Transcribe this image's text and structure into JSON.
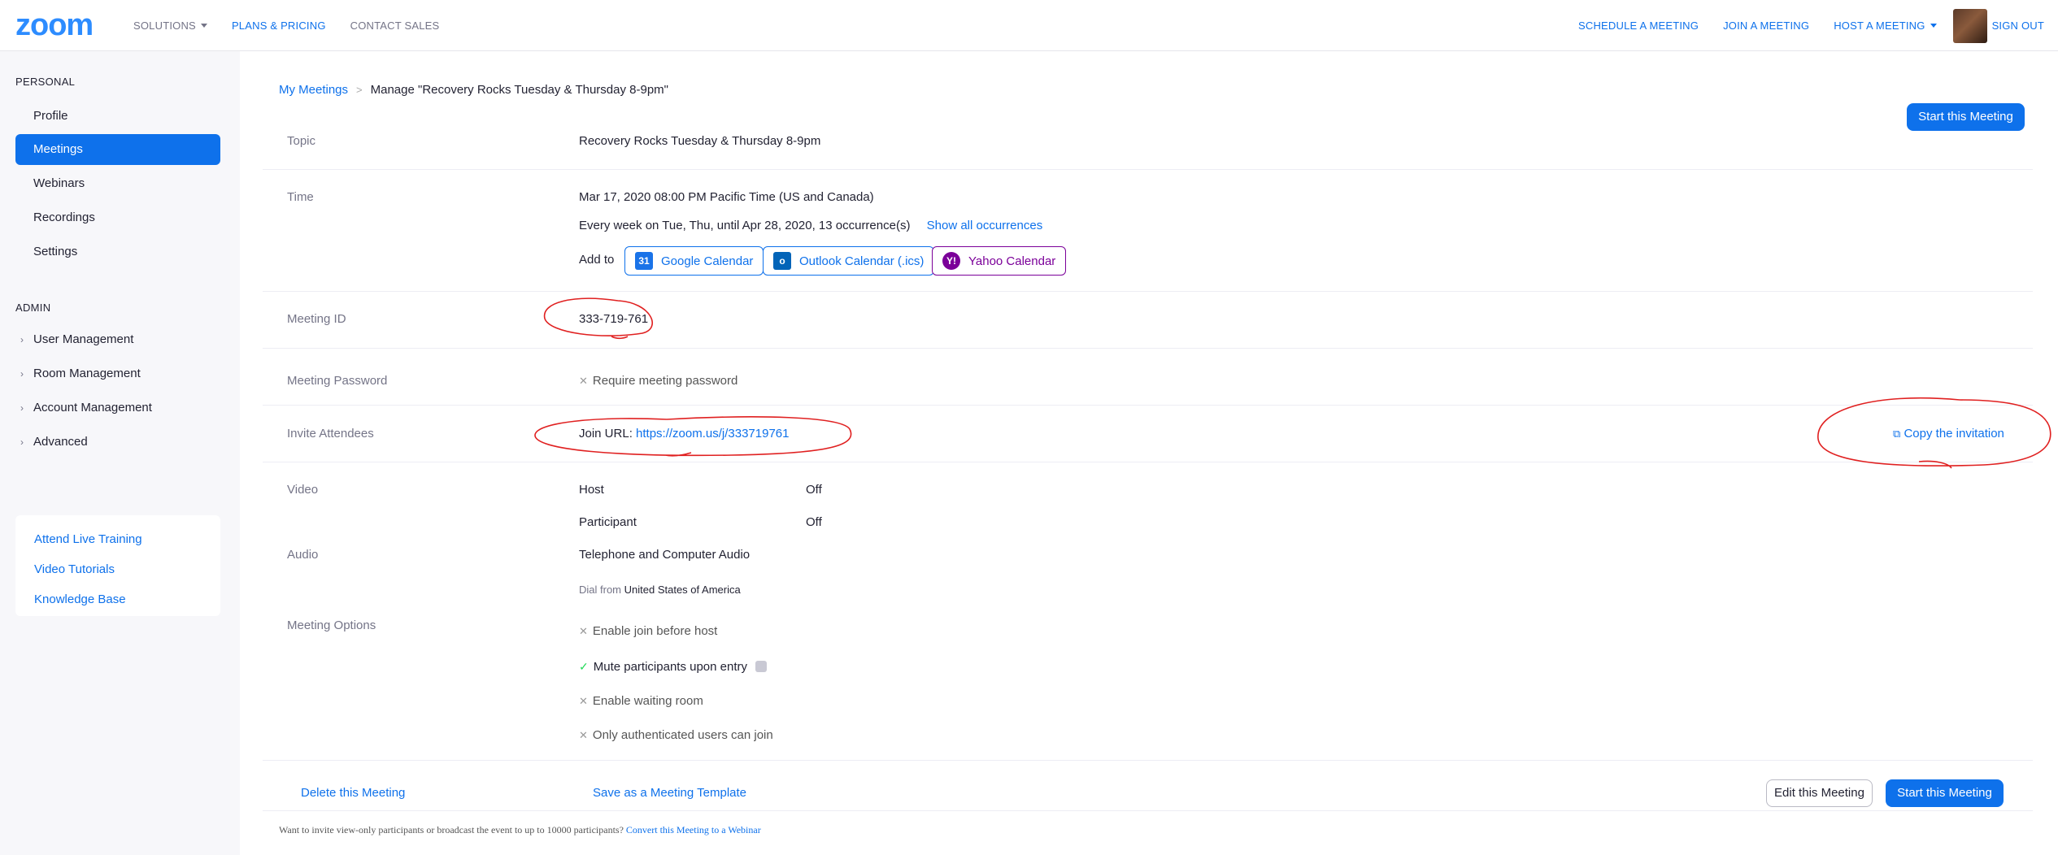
{
  "header": {
    "logo": "zoom",
    "nav_left": [
      "SOLUTIONS",
      "PLANS & PRICING",
      "CONTACT SALES"
    ],
    "nav_right": [
      "SCHEDULE A MEETING",
      "JOIN A MEETING",
      "HOST A MEETING",
      "SIGN OUT"
    ]
  },
  "sidebar": {
    "personal_label": "PERSONAL",
    "personal_items": [
      "Profile",
      "Meetings",
      "Webinars",
      "Recordings",
      "Settings"
    ],
    "admin_label": "ADMIN",
    "admin_items": [
      "User Management",
      "Room Management",
      "Account Management",
      "Advanced"
    ],
    "help_links": [
      "Attend Live Training",
      "Video Tutorials",
      "Knowledge Base"
    ]
  },
  "breadcrumb": {
    "parent": "My Meetings",
    "separator": ">",
    "current": "Manage \"Recovery Rocks Tuesday & Thursday 8-9pm\""
  },
  "actions": {
    "start_top": "Start this Meeting",
    "delete": "Delete this Meeting",
    "save_template": "Save as a Meeting Template",
    "edit": "Edit this Meeting",
    "start_bottom": "Start this Meeting"
  },
  "topic": {
    "label": "Topic",
    "value": "Recovery Rocks Tuesday & Thursday 8-9pm"
  },
  "time": {
    "label": "Time",
    "value": "Mar 17, 2020 08:00 PM Pacific Time (US and Canada)",
    "recurrence": "Every week on Tue, Thu, until Apr 28, 2020, 13 occurrence(s)",
    "show_all": "Show all occurrences",
    "add_to": "Add to",
    "calendars": [
      "Google Calendar",
      "Outlook Calendar (.ics)",
      "Yahoo Calendar"
    ]
  },
  "meeting_id": {
    "label": "Meeting ID",
    "value": "333-719-761"
  },
  "password": {
    "label": "Meeting Password",
    "value": "Require meeting password"
  },
  "invite": {
    "label": "Invite Attendees",
    "join_label": "Join URL:",
    "join_url": "https://zoom.us/j/333719761",
    "copy": "Copy the invitation"
  },
  "video": {
    "label": "Video",
    "host_label": "Host",
    "host_value": "Off",
    "participant_label": "Participant",
    "participant_value": "Off"
  },
  "audio": {
    "label": "Audio",
    "value": "Telephone and Computer Audio",
    "dial_prefix": "Dial from",
    "dial_country": "United States of America"
  },
  "options": {
    "label": "Meeting Options",
    "items": [
      "Enable join before host",
      "Mute participants upon entry",
      "Enable waiting room",
      "Only authenticated users can join"
    ]
  },
  "footer": {
    "note": "Want to invite view-only participants or broadcast the event to up to 10000 participants?",
    "link": "Convert this Meeting to a Webinar"
  },
  "colors": {
    "accent": "#0e71eb",
    "brand": "#2d8cff",
    "annotation": "#e02020",
    "yahoo": "#7b0099"
  }
}
